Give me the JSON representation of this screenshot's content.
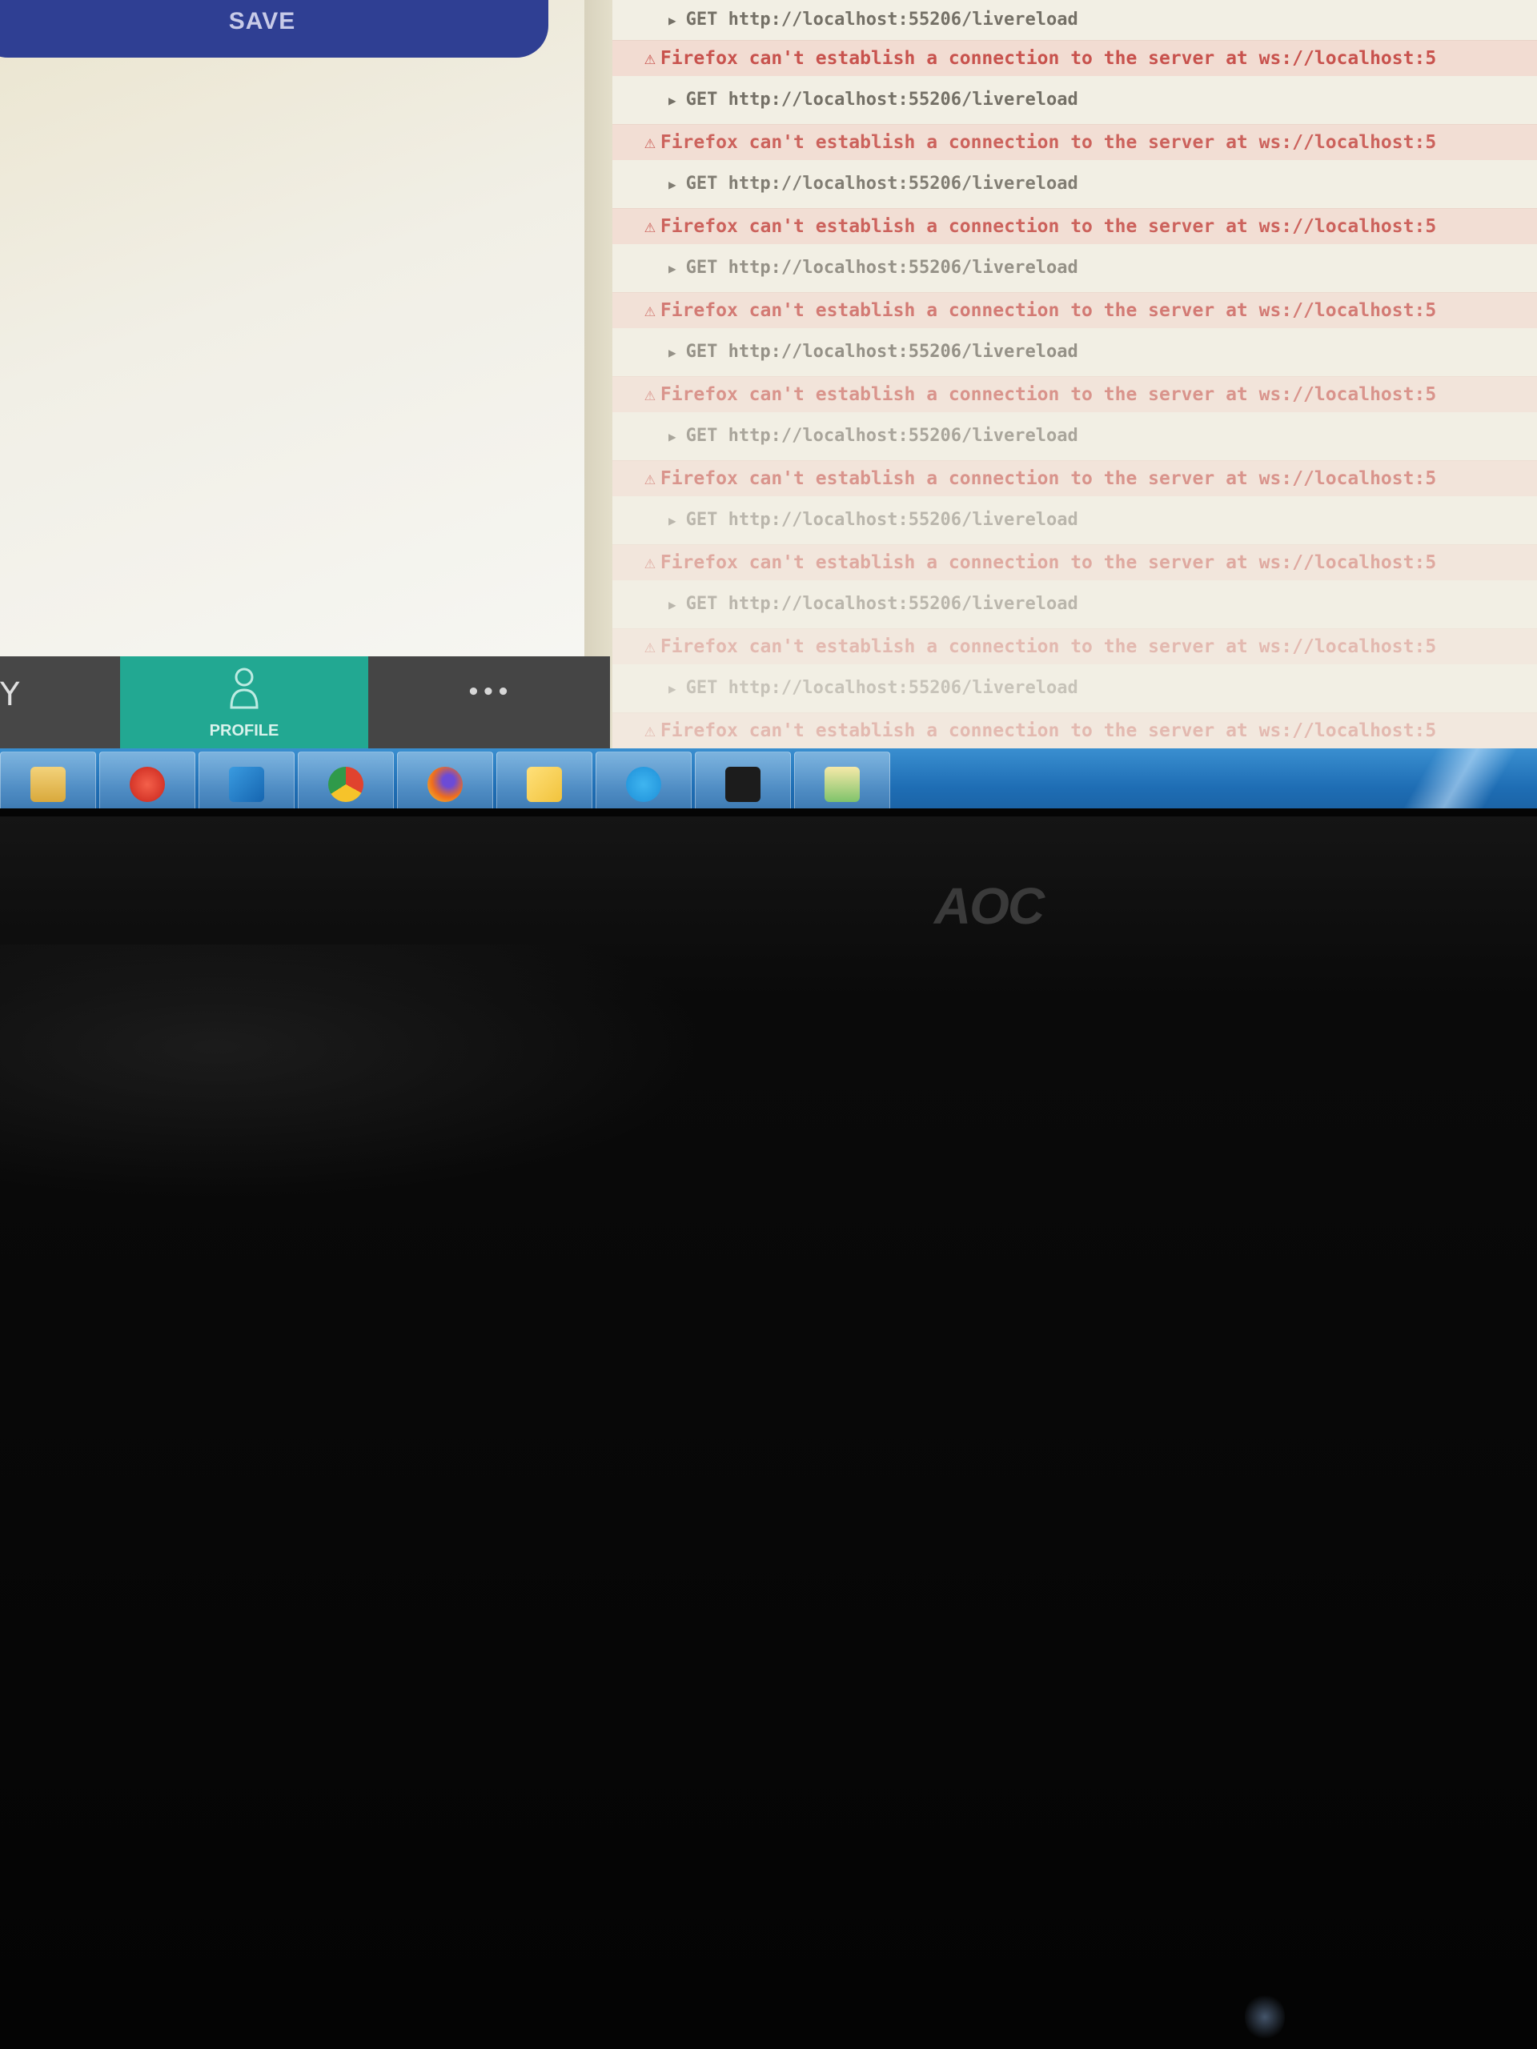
{
  "app": {
    "save_label": "SAVE",
    "nav": {
      "profile_label": "PROFILE",
      "more_label": "•••",
      "first_glyph": "Y"
    }
  },
  "console": {
    "entries": [
      {
        "request": "GET http://localhost:55206/livereload"
      },
      {
        "error": "Firefox can't establish a connection to the server at ws://localhost:5"
      },
      {
        "request": "GET http://localhost:55206/livereload"
      },
      {
        "error": "Firefox can't establish a connection to the server at ws://localhost:5"
      },
      {
        "request": "GET http://localhost:55206/livereload"
      },
      {
        "error": "Firefox can't establish a connection to the server at ws://localhost:5"
      },
      {
        "request": "GET http://localhost:55206/livereload"
      },
      {
        "error": "Firefox can't establish a connection to the server at ws://localhost:5"
      },
      {
        "request": "GET http://localhost:55206/livereload"
      },
      {
        "error": "Firefox can't establish a connection to the server at ws://localhost:5"
      },
      {
        "request": "GET http://localhost:55206/livereload"
      },
      {
        "error": "Firefox can't establish a connection to the server at ws://localhost:5"
      },
      {
        "request": "GET http://localhost:55206/livereload"
      },
      {
        "error": "Firefox can't establish a connection to the server at ws://localhost:5"
      },
      {
        "request": "GET http://localhost:55206/livereload"
      },
      {
        "error": "Firefox can't establish a connection to the server at ws://localhost:5"
      },
      {
        "request": "GET http://localhost:55206/livereload"
      },
      {
        "error": "Firefox can't establish a connection to the server at ws://localhost:5"
      }
    ]
  },
  "taskbar": {
    "icons": [
      "folder-icon",
      "filezilla-icon",
      "vscode-icon",
      "chrome-icon",
      "firefox-icon",
      "sticky-notes-icon",
      "skype-icon",
      "terminal-icon",
      "photos-icon"
    ]
  },
  "monitor": {
    "brand": "AOC"
  },
  "colors": {
    "save_button": "#2f3f93",
    "profile_tab": "#22a892",
    "error_text": "#c64a45",
    "error_bg": "#f3dcd2",
    "taskbar": "#1e6db4"
  }
}
